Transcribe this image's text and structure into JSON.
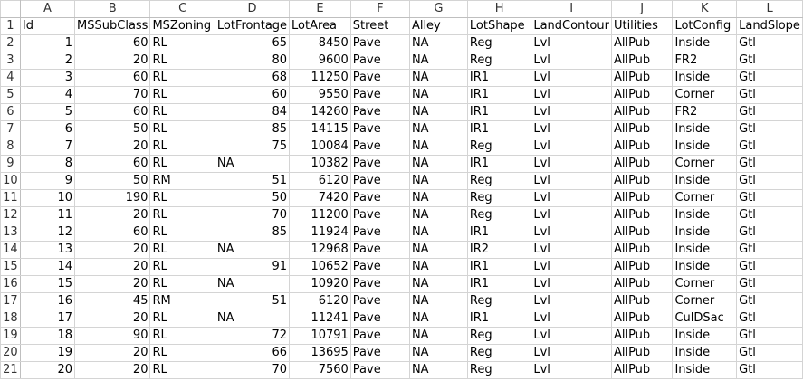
{
  "sheet": {
    "columns": [
      "A",
      "B",
      "C",
      "D",
      "E",
      "F",
      "G",
      "H",
      "I",
      "J",
      "K",
      "L"
    ],
    "header_row": [
      "Id",
      "MSSubClass",
      "MSZoning",
      "LotFrontage",
      "LotArea",
      "Street",
      "Alley",
      "LotShape",
      "LandContour",
      "Utilities",
      "LotConfig",
      "LandSlope"
    ],
    "rows": [
      [
        "1",
        "60",
        "RL",
        "65",
        "8450",
        "Pave",
        "NA",
        "Reg",
        "Lvl",
        "AllPub",
        "Inside",
        "Gtl"
      ],
      [
        "2",
        "20",
        "RL",
        "80",
        "9600",
        "Pave",
        "NA",
        "Reg",
        "Lvl",
        "AllPub",
        "FR2",
        "Gtl"
      ],
      [
        "3",
        "60",
        "RL",
        "68",
        "11250",
        "Pave",
        "NA",
        "IR1",
        "Lvl",
        "AllPub",
        "Inside",
        "Gtl"
      ],
      [
        "4",
        "70",
        "RL",
        "60",
        "9550",
        "Pave",
        "NA",
        "IR1",
        "Lvl",
        "AllPub",
        "Corner",
        "Gtl"
      ],
      [
        "5",
        "60",
        "RL",
        "84",
        "14260",
        "Pave",
        "NA",
        "IR1",
        "Lvl",
        "AllPub",
        "FR2",
        "Gtl"
      ],
      [
        "6",
        "50",
        "RL",
        "85",
        "14115",
        "Pave",
        "NA",
        "IR1",
        "Lvl",
        "AllPub",
        "Inside",
        "Gtl"
      ],
      [
        "7",
        "20",
        "RL",
        "75",
        "10084",
        "Pave",
        "NA",
        "Reg",
        "Lvl",
        "AllPub",
        "Inside",
        "Gtl"
      ],
      [
        "8",
        "60",
        "RL",
        "NA",
        "10382",
        "Pave",
        "NA",
        "IR1",
        "Lvl",
        "AllPub",
        "Corner",
        "Gtl"
      ],
      [
        "9",
        "50",
        "RM",
        "51",
        "6120",
        "Pave",
        "NA",
        "Reg",
        "Lvl",
        "AllPub",
        "Inside",
        "Gtl"
      ],
      [
        "10",
        "190",
        "RL",
        "50",
        "7420",
        "Pave",
        "NA",
        "Reg",
        "Lvl",
        "AllPub",
        "Corner",
        "Gtl"
      ],
      [
        "11",
        "20",
        "RL",
        "70",
        "11200",
        "Pave",
        "NA",
        "Reg",
        "Lvl",
        "AllPub",
        "Inside",
        "Gtl"
      ],
      [
        "12",
        "60",
        "RL",
        "85",
        "11924",
        "Pave",
        "NA",
        "IR1",
        "Lvl",
        "AllPub",
        "Inside",
        "Gtl"
      ],
      [
        "13",
        "20",
        "RL",
        "NA",
        "12968",
        "Pave",
        "NA",
        "IR2",
        "Lvl",
        "AllPub",
        "Inside",
        "Gtl"
      ],
      [
        "14",
        "20",
        "RL",
        "91",
        "10652",
        "Pave",
        "NA",
        "IR1",
        "Lvl",
        "AllPub",
        "Inside",
        "Gtl"
      ],
      [
        "15",
        "20",
        "RL",
        "NA",
        "10920",
        "Pave",
        "NA",
        "IR1",
        "Lvl",
        "AllPub",
        "Corner",
        "Gtl"
      ],
      [
        "16",
        "45",
        "RM",
        "51",
        "6120",
        "Pave",
        "NA",
        "Reg",
        "Lvl",
        "AllPub",
        "Corner",
        "Gtl"
      ],
      [
        "17",
        "20",
        "RL",
        "NA",
        "11241",
        "Pave",
        "NA",
        "IR1",
        "Lvl",
        "AllPub",
        "CulDSac",
        "Gtl"
      ],
      [
        "18",
        "90",
        "RL",
        "72",
        "10791",
        "Pave",
        "NA",
        "Reg",
        "Lvl",
        "AllPub",
        "Inside",
        "Gtl"
      ],
      [
        "19",
        "20",
        "RL",
        "66",
        "13695",
        "Pave",
        "NA",
        "Reg",
        "Lvl",
        "AllPub",
        "Inside",
        "Gtl"
      ],
      [
        "20",
        "20",
        "RL",
        "70",
        "7560",
        "Pave",
        "NA",
        "Reg",
        "Lvl",
        "AllPub",
        "Inside",
        "Gtl"
      ]
    ],
    "numeric_columns": [
      0,
      1,
      4
    ]
  }
}
